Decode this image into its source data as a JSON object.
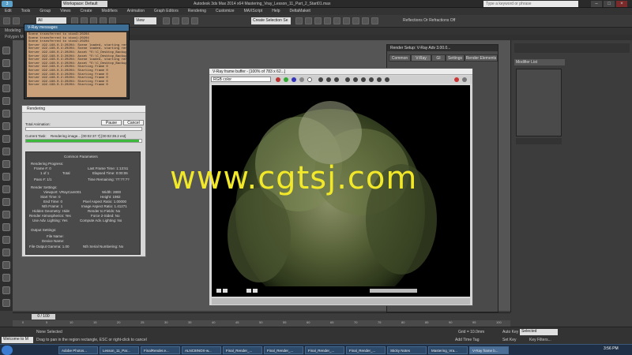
{
  "window": {
    "title": "Autodesk 3ds Max 2014 x64     Mastering_Vray_Lesson_11_Part_2_Start01.max",
    "workspace": "Workspace: Default",
    "search_placeholder": "Type a keyword or phrase"
  },
  "menu": [
    "Edit",
    "Tools",
    "Group",
    "Views",
    "Create",
    "Modifiers",
    "Animation",
    "Graph Editors",
    "Rendering",
    "Customize",
    "MAXScript",
    "Help",
    "DeltaMakeit"
  ],
  "toolbar": {
    "filter_value": "All",
    "view_value": "View",
    "selection_set": "Create Selection Se",
    "reflections_label": "Reflections Or Refractions Off"
  },
  "ribbon": {
    "tabs": [
      "Modeling",
      "Freeform",
      "Selection",
      "Object Paint",
      "Populate"
    ],
    "sub": "Polygon Modeling"
  },
  "vray_messages": {
    "title": "V-Ray messages",
    "lines": [
      "Scene transferred to stan3:20204",
      "Scene transferred to stan1:20204",
      "Scene transferred to stan2:20204",
      "Server 192.168.0.3:20204: Scene loaded, starting render",
      "Server 192.168.0.4:20204: Scene loaded, starting render",
      "Server 192.168.0.2:20204: Asset \"E:\\C_Desktop_Backup\\",
      "Server 192.168.0.3:20204: Asset \"E:\\C_Desktop_Backup\\",
      "Server 192.168.0.4:20204: Scene loaded, starting render",
      "Server 192.168.0.4:20204: Asset \"E:\\C_Desktop_Backup\\",
      "Server 192.168.0.2:20204: Starting frame 0",
      "Server 192.168.0.3:20204: Starting frame 0",
      "Server 192.168.0.4:20204: Starting frame 0",
      "Server 192.168.0.2:20204: Starting frame 0",
      "Server 192.168.0.3:20204: Starting frame 0",
      "Server 192.168.0.3:20204: Starting frame 0"
    ]
  },
  "rendering": {
    "title": "Rendering",
    "pause": "Pause",
    "cancel": "Cancel",
    "total_animation": "Total Animation:",
    "current_task_label": "Current Task:",
    "current_task": "Rendering image... [00:02:37.7] [00:02:39.2 est]",
    "progress": 0.98,
    "common_parameters": "Common Parameters",
    "rendering_progress": "Rendering Progress:",
    "frame": "Frame #: 0",
    "one_of_one": "1 of 1",
    "total": "Total",
    "pass": "Pass #: 1/1",
    "last_frame_time": "Last Frame Time: 1:13:51",
    "elapsed_time": "Elapsed Time: 0:00:06",
    "time_remaining": "Time Remaining: ??:??:??",
    "render_settings": "Render Settings:",
    "viewport": "Viewport: VRayCam001",
    "start_time": "Start Time: 0",
    "end_time": "End Time: 0",
    "nth_frame": "Nth Frame: 1",
    "hidden_geometry": "Hidden Geometry: Hide",
    "render_atmospherics": "Render Atmospherics: Yes",
    "use_adv_lighting": "Use Adv. Lighting: Yes",
    "width": "Width: 2800",
    "height": "Height: 1982",
    "pixel_aspect": "Pixel Aspect Ratio: 1.00000",
    "image_aspect": "Image Aspect Ratio: 1.41271",
    "render_to_fields": "Render to Fields: No",
    "force_2sided": "Force 2-Sided: No",
    "compute_adv": "Compute Adv. Lighting: No",
    "output_settings": "Output Settings:",
    "file_name": "File Name:",
    "device_name": "Device Name:",
    "file_gamma": "File Output Gamma: 1.00",
    "nth_serial": "Nth Serial Numbering: No"
  },
  "framebuffer": {
    "title": "V-Ray frame buffer - [100% of 783 x 62...]",
    "channel": "RGB color"
  },
  "render_setup": {
    "title": "Render Setup: V-Ray Adv 3.00.0...",
    "tabs": [
      "Common",
      "V-Ray",
      "GI",
      "Settings",
      "Render Elements"
    ]
  },
  "command_panel": {
    "modifier_list": "Modifier List"
  },
  "watermark": "www.cgtsj.com",
  "timeline": {
    "slider": "0 / 100",
    "ticks": [
      "0",
      "5",
      "10",
      "15",
      "20",
      "25",
      "30",
      "35",
      "40",
      "45",
      "50",
      "55",
      "60",
      "65",
      "70",
      "75",
      "80",
      "85",
      "90",
      "95",
      "100"
    ]
  },
  "status": {
    "listener": "Welcome to M",
    "selected": "None Selected",
    "prompt": "Drag to pan in the region rectangle, ESC or right-click to cancel",
    "grid": "Grid = 10.0mm",
    "add_time_tag": "Add Time Tag",
    "auto_key": "Auto Key",
    "selected_dd": "Selected",
    "set_key": "Set Key",
    "key_filters": "Key Filters...",
    "time": "3:56 PM"
  },
  "taskbar": [
    "Adobe Photos...",
    "Lesson_11_Par...",
    "FinalRender.e...",
    "ALNC8INOX-w...",
    "Final_Render_...",
    "Final_Render_...",
    "Final_Render_...",
    "Final_Render_...",
    "Sticky Notes",
    "Mastering_Vra...",
    "V-Ray frame b..."
  ],
  "colors": {
    "progress_green": "#3cb83c",
    "watermark_yellow": "#f2e82a",
    "vray_log_bg": "#c8a07a"
  }
}
